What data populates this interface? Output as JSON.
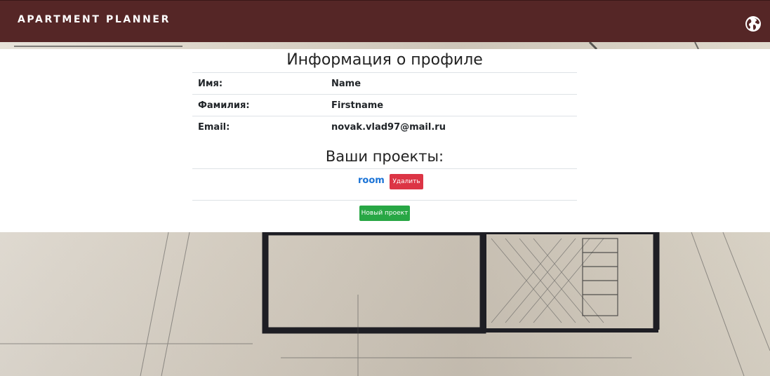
{
  "header": {
    "brand": "APARTMENT PLANNER",
    "language_icon": "globe-icon"
  },
  "profile": {
    "title": "Информация о профиле",
    "rows": [
      {
        "label": "Имя:",
        "value": "Name"
      },
      {
        "label": "Фамилия:",
        "value": "Firstname"
      },
      {
        "label": "Email:",
        "value": "novak.vlad97@mail.ru"
      }
    ]
  },
  "projects": {
    "title": "Ваши проекты:",
    "items": [
      {
        "name": "room",
        "delete_label": "Удалить"
      }
    ],
    "new_project_label": "Новый проект"
  },
  "colors": {
    "header_bg": "#552626",
    "link": "#1a73d6",
    "danger": "#dc3545",
    "success": "#28a745"
  }
}
